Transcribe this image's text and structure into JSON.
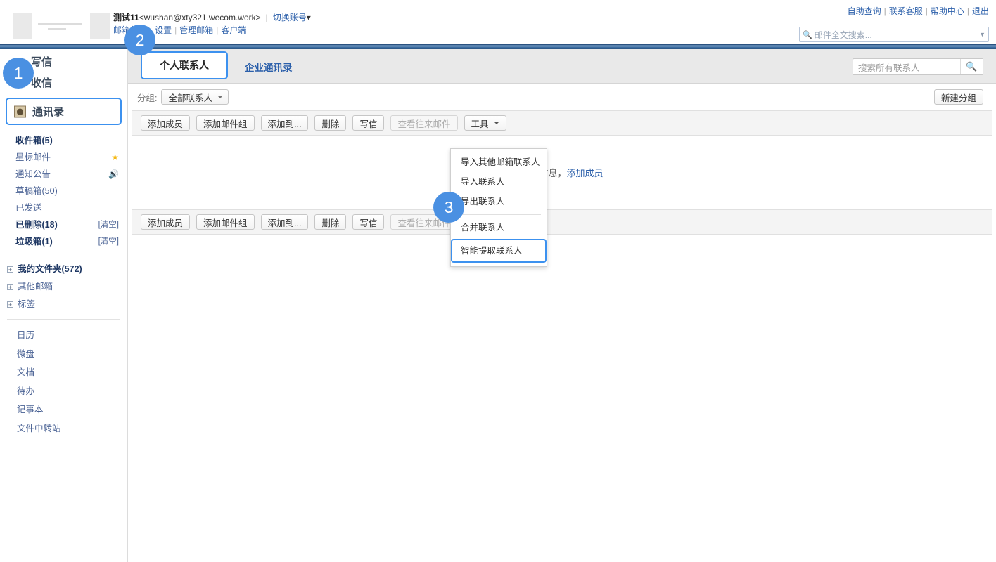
{
  "header": {
    "account_name": "测试11",
    "account_email": "<wushan@xty321.wecom.work>",
    "switch_account": "切换账号",
    "sub_links": [
      "邮箱首页",
      "设置",
      "管理邮箱",
      "客户端"
    ],
    "top_links": [
      "自助查询",
      "联系客服",
      "帮助中心",
      "退出"
    ],
    "search_placeholder": "邮件全文搜索...",
    "search_icon": "search-icon",
    "caret_icon": "chevron-down-icon"
  },
  "sidebar": {
    "compose": "写信",
    "receive": "收信",
    "addressbook": "通讯录",
    "addressbook_icon": "address-book-icon",
    "folders": [
      {
        "name": "收件箱(5)",
        "bold": true,
        "icon": "",
        "action": ""
      },
      {
        "name": "星标邮件",
        "bold": false,
        "icon": "star-icon",
        "action": ""
      },
      {
        "name": "通知公告",
        "bold": false,
        "icon": "speaker-icon",
        "action": ""
      },
      {
        "name": "草稿箱(50)",
        "bold": false,
        "icon": "",
        "action": ""
      },
      {
        "name": "已发送",
        "bold": false,
        "icon": "",
        "action": ""
      },
      {
        "name": "已删除(18)",
        "bold": true,
        "icon": "",
        "action": "[清空]"
      },
      {
        "name": "垃圾箱(1)",
        "bold": true,
        "icon": "",
        "action": "[清空]"
      }
    ],
    "trees": [
      {
        "name": "我的文件夹(572)",
        "bold": true
      },
      {
        "name": "其他邮箱",
        "bold": false
      },
      {
        "name": "标签",
        "bold": false
      }
    ],
    "apps": [
      "日历",
      "微盘",
      "文档",
      "待办",
      "记事本",
      "文件中转站"
    ]
  },
  "main": {
    "tabs": [
      {
        "label": "个人联系人",
        "active": true
      },
      {
        "label": "企业通讯录",
        "active": false
      }
    ],
    "contact_search_placeholder": "搜索所有联系人",
    "contact_search_icon": "search-icon",
    "group_label": "分组:",
    "group_value": "全部联系人",
    "new_group_button": "新建分组",
    "toolbar": [
      {
        "label": "添加成员",
        "disabled": false,
        "caret": false
      },
      {
        "label": "添加邮件组",
        "disabled": false,
        "caret": false
      },
      {
        "label": "添加到...",
        "disabled": false,
        "caret": false
      },
      {
        "label": "删除",
        "disabled": false,
        "caret": false
      },
      {
        "label": "写信",
        "disabled": false,
        "caret": false
      },
      {
        "label": "查看往来邮件",
        "disabled": true,
        "caret": false
      },
      {
        "label": "工具",
        "disabled": false,
        "caret": true
      }
    ],
    "empty_text_prefix": "系人信息，",
    "empty_link": "添加成员"
  },
  "tools_menu": {
    "items": [
      {
        "label": "导入其他邮箱联系人",
        "highlight": false,
        "separator_after": false
      },
      {
        "label": "导入联系人",
        "highlight": false,
        "separator_after": false
      },
      {
        "label": "导出联系人",
        "highlight": false,
        "separator_after": true
      },
      {
        "label": "合并联系人",
        "highlight": false,
        "separator_after": false
      },
      {
        "label": "智能提取联系人",
        "highlight": true,
        "separator_after": false
      }
    ]
  },
  "badges": [
    {
      "number": "1"
    },
    {
      "number": "2"
    },
    {
      "number": "3"
    }
  ],
  "colors": {
    "accent_blue": "#3c91ef",
    "badge_blue": "#4a90e2",
    "navy_strip": "#3b6ca0",
    "link_blue": "#2b5faa"
  }
}
